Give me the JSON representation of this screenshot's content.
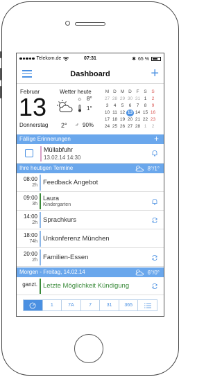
{
  "statusbar": {
    "carrier": "Telekom.de",
    "time": "07:31",
    "battery": "65 %"
  },
  "navbar": {
    "title": "Dashboard",
    "menu_icon": "hamburger-menu-icon",
    "add_icon": "plus-icon"
  },
  "header": {
    "month": "Februar",
    "day": "13",
    "weekday": "Donnerstag",
    "weather_label": "Wetter heute",
    "temp_max": "8°",
    "temp_min": "1°",
    "temp_now": "2°",
    "rain_chance": "90%",
    "calendar": {
      "weekdays": [
        "M",
        "D",
        "M",
        "D",
        "F",
        "S",
        "S"
      ],
      "weeks": [
        [
          "27",
          "28",
          "29",
          "30",
          "31",
          "1",
          "2"
        ],
        [
          "3",
          "4",
          "5",
          "6",
          "7",
          "8",
          "9"
        ],
        [
          "10",
          "11",
          "12",
          "13",
          "14",
          "15",
          "16"
        ],
        [
          "17",
          "18",
          "19",
          "20",
          "21",
          "22",
          "23"
        ],
        [
          "24",
          "25",
          "26",
          "27",
          "28",
          "1",
          "2"
        ]
      ],
      "today": "13"
    }
  },
  "sections": {
    "reminders": {
      "label": "Fällige Erinnerungen",
      "add": "+"
    },
    "today": {
      "label": "Ihre heutigen Termine",
      "weather": "8°/1°"
    },
    "tomorrow": {
      "label": "Morgen - Freitag, 14.02.14",
      "weather": "6°/0°"
    }
  },
  "reminder": {
    "title": "Müllabfuhr",
    "date": "13.02.14 14:30"
  },
  "appointments": [
    {
      "time": "08:00",
      "duration": "2h",
      "title": "Feedback Angebot",
      "subtitle": "",
      "icon": "",
      "color": "#8fb8e8"
    },
    {
      "time": "09:00",
      "duration": "3h",
      "title": "Laura",
      "subtitle": "Kindergarten",
      "icon": "bell-icon",
      "color": "#3a8a3a"
    },
    {
      "time": "14:00",
      "duration": "2h",
      "title": "Sprachkurs",
      "subtitle": "",
      "icon": "repeat-icon",
      "color": "#8fb8e8"
    },
    {
      "time": "18:00",
      "duration": "74h",
      "title": "Unkonferenz München",
      "subtitle": "",
      "icon": "",
      "color": "#8fb8e8"
    },
    {
      "time": "20:00",
      "duration": "2h",
      "title": "Familien-Essen",
      "subtitle": "",
      "icon": "repeat-icon",
      "color": "#8fb8e8"
    }
  ],
  "tomorrow_appt": {
    "time": "ganzt.",
    "title": "Letzte Möglichkeit Kündigung",
    "icon": "repeat-icon",
    "color": "#3a8a3a"
  },
  "toolbar": {
    "items": [
      "",
      "1",
      "7A",
      "7",
      "31",
      "365",
      ""
    ]
  },
  "colors": {
    "accent": "#4a90e2",
    "bar": "#6aa7ec",
    "green": "#3a8a3a",
    "sunday": "#d9534f"
  }
}
